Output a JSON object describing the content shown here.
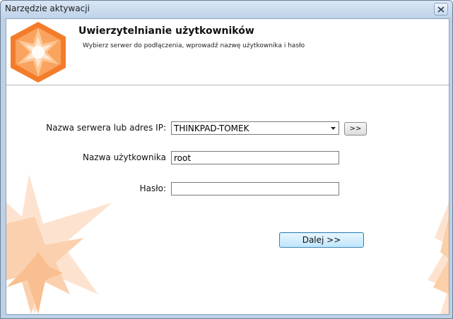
{
  "window": {
    "title": "Narzędzie aktywacji"
  },
  "header": {
    "title": "Uwierzytelnianie użytkowników",
    "subtitle": "Wybierz serwer do podłączenia, wprowadź nazwę użytkownika i hasło"
  },
  "form": {
    "server": {
      "label": "Nazwa serwera lub adres IP:",
      "value": "THINKPAD-TOMEK",
      "browse_label": ">>"
    },
    "username": {
      "label": "Nazwa użytkownika",
      "value": "root"
    },
    "password": {
      "label": "Hasło:",
      "value": ""
    },
    "next_label": "Dalej >>"
  },
  "icons": {
    "logo": "star-hexagon-logo",
    "close": "close-icon",
    "dropdown": "chevron-down-icon"
  },
  "colors": {
    "accent_orange": "#f7a160",
    "title_bar": "#bfd3ea",
    "primary_button_border": "#3c7fb1"
  }
}
